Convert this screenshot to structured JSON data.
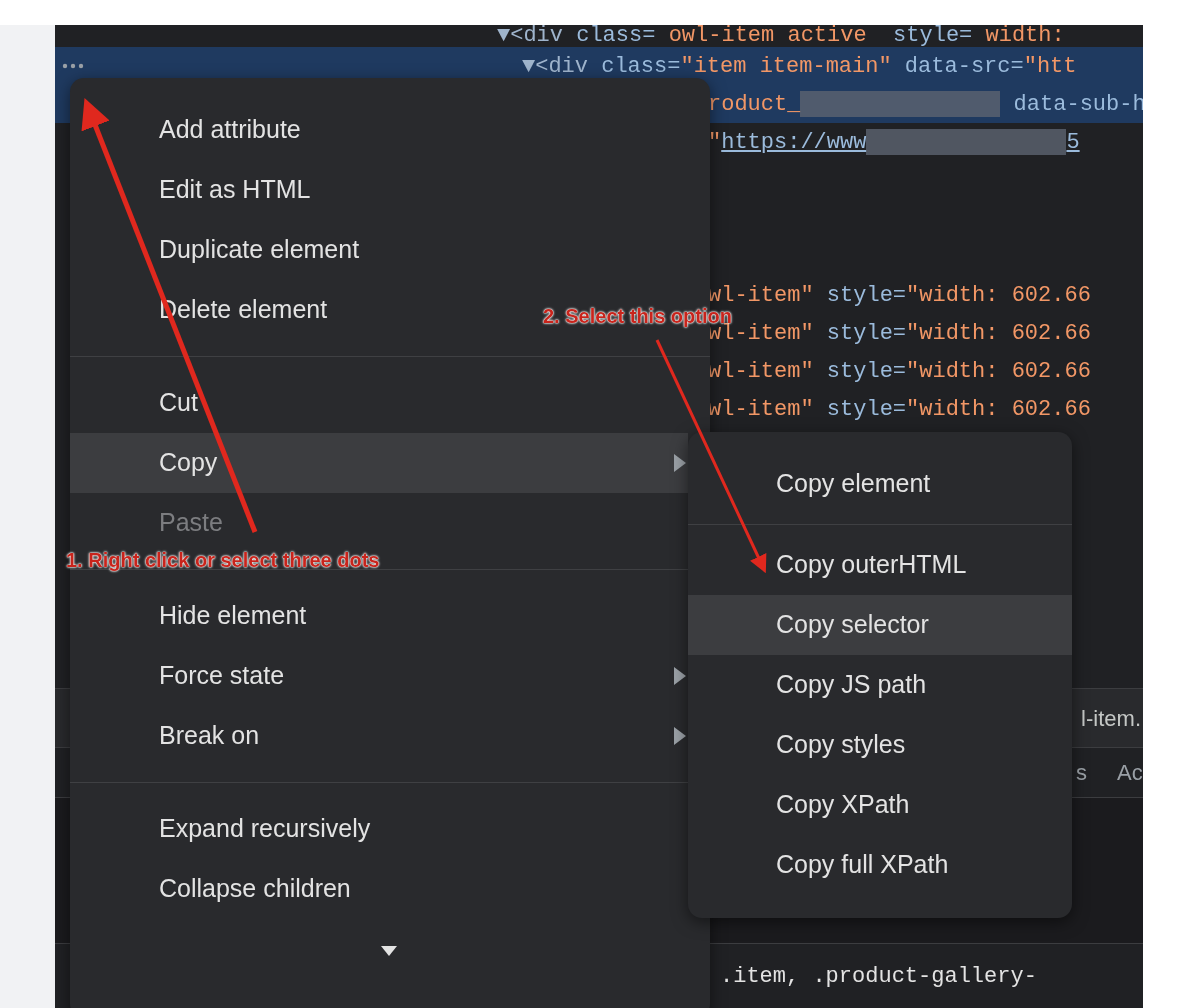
{
  "elements_panel": {
    "lines": [
      {
        "selected": false,
        "segments": [
          {
            "kind": "tag",
            "text": "▼<div"
          },
          {
            "kind": "attr",
            "text": " class="
          },
          {
            "kind": "value",
            "text": " owl-item active "
          },
          {
            "kind": "attr",
            "text": " style="
          },
          {
            "kind": "value",
            "text": " width:"
          }
        ]
      },
      {
        "selected": true,
        "segments": [
          {
            "kind": "tag",
            "text": "▼<div"
          },
          {
            "kind": "attr",
            "text": " class="
          },
          {
            "kind": "value",
            "text": "\"item item-main\""
          },
          {
            "kind": "attr",
            "text": " data-src="
          },
          {
            "kind": "value",
            "text": "\"htt"
          }
        ]
      },
      {
        "selected": true,
        "segments": [
          {
            "kind": "value",
            "text": "roduct_"
          },
          {
            "kind": "redacted"
          },
          {
            "kind": "attr",
            "text": " data-sub-h"
          }
        ]
      },
      {
        "selected": false,
        "segments": [
          {
            "kind": "value",
            "text": "\""
          },
          {
            "kind": "link",
            "text": "https://www"
          },
          {
            "kind": "redacted"
          },
          {
            "kind": "link",
            "text": "5"
          }
        ]
      },
      {
        "selected": false,
        "segments": [
          {
            "kind": "value",
            "text": "wl-item\""
          },
          {
            "kind": "attr",
            "text": " style="
          },
          {
            "kind": "value",
            "text": "\"width: 602.66"
          }
        ]
      },
      {
        "selected": false,
        "segments": [
          {
            "kind": "value",
            "text": "wl-item\""
          },
          {
            "kind": "attr",
            "text": " style="
          },
          {
            "kind": "value",
            "text": "\"width: 602.66"
          }
        ]
      },
      {
        "selected": false,
        "segments": [
          {
            "kind": "value",
            "text": "wl-item\""
          },
          {
            "kind": "attr",
            "text": " style="
          },
          {
            "kind": "value",
            "text": "\"width: 602.66"
          }
        ]
      },
      {
        "selected": false,
        "segments": [
          {
            "kind": "value",
            "text": "wl-item\""
          },
          {
            "kind": "attr",
            "text": " style="
          },
          {
            "kind": "value",
            "text": "\"width: 602.66"
          }
        ]
      }
    ]
  },
  "breadcrumb": {
    "text": "l-item."
  },
  "tabs_row": {
    "tabs": [
      "s",
      "Ac"
    ]
  },
  "styles_line": {
    "text": ".item, .product-gallery-"
  },
  "context_menu": {
    "items": [
      {
        "kind": "item",
        "label": "Add attribute",
        "selected": false,
        "disabled": false,
        "submenu": false
      },
      {
        "kind": "item",
        "label": "Edit as HTML",
        "selected": false,
        "disabled": false,
        "submenu": false
      },
      {
        "kind": "item",
        "label": "Duplicate element",
        "selected": false,
        "disabled": false,
        "submenu": false
      },
      {
        "kind": "item",
        "label": "Delete element",
        "selected": false,
        "disabled": false,
        "submenu": false
      },
      {
        "kind": "separator"
      },
      {
        "kind": "item",
        "label": "Cut",
        "selected": false,
        "disabled": false,
        "submenu": false
      },
      {
        "kind": "item",
        "label": "Copy",
        "selected": true,
        "disabled": false,
        "submenu": true
      },
      {
        "kind": "item",
        "label": "Paste",
        "selected": false,
        "disabled": true,
        "submenu": false
      },
      {
        "kind": "separator"
      },
      {
        "kind": "item",
        "label": "Hide element",
        "selected": false,
        "disabled": false,
        "submenu": false
      },
      {
        "kind": "item",
        "label": "Force state",
        "selected": false,
        "disabled": false,
        "submenu": true
      },
      {
        "kind": "item",
        "label": "Break on",
        "selected": false,
        "disabled": false,
        "submenu": true
      },
      {
        "kind": "separator"
      },
      {
        "kind": "item",
        "label": "Expand recursively",
        "selected": false,
        "disabled": false,
        "submenu": false
      },
      {
        "kind": "item",
        "label": "Collapse children",
        "selected": false,
        "disabled": false,
        "submenu": false
      }
    ]
  },
  "copy_submenu": {
    "items": [
      {
        "kind": "item",
        "label": "Copy element",
        "selected": false
      },
      {
        "kind": "separator"
      },
      {
        "kind": "item",
        "label": "Copy outerHTML",
        "selected": false
      },
      {
        "kind": "item",
        "label": "Copy selector",
        "selected": true
      },
      {
        "kind": "item",
        "label": "Copy JS path",
        "selected": false
      },
      {
        "kind": "item",
        "label": "Copy styles",
        "selected": false
      },
      {
        "kind": "item",
        "label": "Copy XPath",
        "selected": false
      },
      {
        "kind": "item",
        "label": "Copy full XPath",
        "selected": false
      }
    ]
  },
  "annotations": [
    {
      "text": "1. Right click or select three dots"
    },
    {
      "text": "2. Select this option"
    }
  ]
}
